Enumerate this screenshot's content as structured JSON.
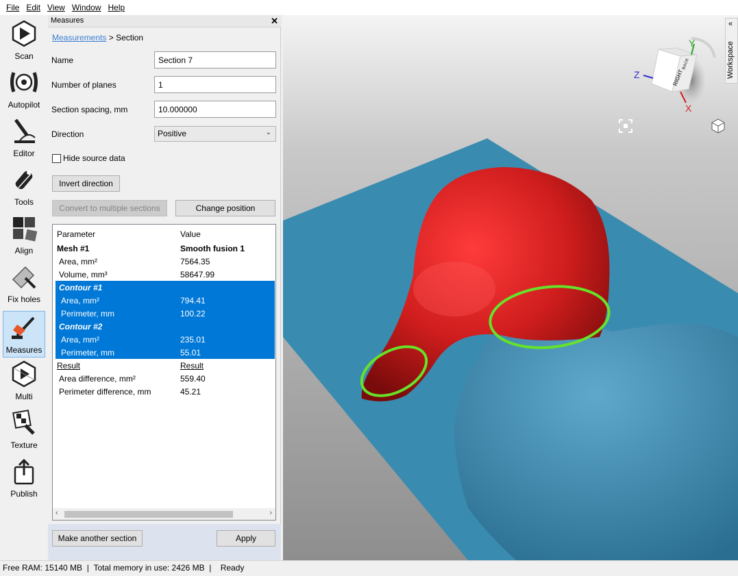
{
  "menu": [
    "File",
    "Edit",
    "View",
    "Window",
    "Help"
  ],
  "tools": [
    {
      "label": "Scan",
      "icon": "scan-icon"
    },
    {
      "label": "Autopilot",
      "icon": "autopilot-icon"
    },
    {
      "label": "Editor",
      "icon": "editor-icon"
    },
    {
      "label": "Tools",
      "icon": "tools-icon"
    },
    {
      "label": "Align",
      "icon": "align-icon"
    },
    {
      "label": "Fix holes",
      "icon": "fix-holes-icon"
    },
    {
      "label": "Measures",
      "icon": "measures-icon",
      "active": true
    },
    {
      "label": "Multi",
      "icon": "multi-icon"
    },
    {
      "label": "Texture",
      "icon": "texture-icon"
    },
    {
      "label": "Publish",
      "icon": "publish-icon"
    }
  ],
  "panel": {
    "title": "Measures",
    "close": "✕",
    "breadcrumb": {
      "link": "Measurements",
      "sep": " > ",
      "current": "Section"
    },
    "fields": {
      "name_label": "Name",
      "name_value": "Section 7",
      "planes_label": "Number of planes",
      "planes_value": "1",
      "spacing_label": "Section spacing, mm",
      "spacing_value": "10.000000",
      "direction_label": "Direction",
      "direction_value": "Positive"
    },
    "hide_source_label": "Hide source data",
    "invert_button": "Invert direction",
    "convert_button": "Convert to multiple sections",
    "change_position_button": "Change position",
    "table": {
      "header": [
        "Parameter",
        "Value"
      ],
      "rows": [
        {
          "p": "Mesh #1",
          "v": "Smooth fusion 1",
          "style": "bold"
        },
        {
          "p": "Area, mm²",
          "v": "7564.35",
          "style": "indent"
        },
        {
          "p": "Volume, mm³",
          "v": "58647.99",
          "style": "indent"
        },
        {
          "p": "Contour #1",
          "v": "",
          "style": "bi-sel"
        },
        {
          "p": "Area, mm²",
          "v": "794.41",
          "style": "indent-sel"
        },
        {
          "p": "Perimeter, mm",
          "v": "100.22",
          "style": "indent-sel"
        },
        {
          "p": "Contour #2",
          "v": "",
          "style": "bi-sel"
        },
        {
          "p": "Area, mm²",
          "v": "235.01",
          "style": "indent-sel"
        },
        {
          "p": "Perimeter, mm",
          "v": "55.01",
          "style": "indent-sel"
        },
        {
          "p": "Result",
          "v": "Result",
          "style": "ul"
        },
        {
          "p": "Area difference, mm²",
          "v": "559.40",
          "style": "indent"
        },
        {
          "p": "Perimeter difference, mm",
          "v": "45.21",
          "style": "indent"
        }
      ]
    },
    "make_another_button": "Make another section",
    "apply_button": "Apply"
  },
  "viewport": {
    "workspace_tab": "Workspace",
    "cube": {
      "right": "RIGHT",
      "back": "BACK"
    },
    "axes": {
      "x": "X",
      "y": "Y",
      "z": "Z"
    },
    "colors": {
      "background": "#a8a8a8",
      "platform": "#3a8bb0",
      "mesh1": "#cc1f1f",
      "mesh2": "#3d88ad",
      "contour": "#66e22a"
    }
  },
  "status": {
    "free_ram": "Free RAM: 15140 MB",
    "total_memory": "Total memory in use: 2426 MB",
    "state": "Ready"
  }
}
